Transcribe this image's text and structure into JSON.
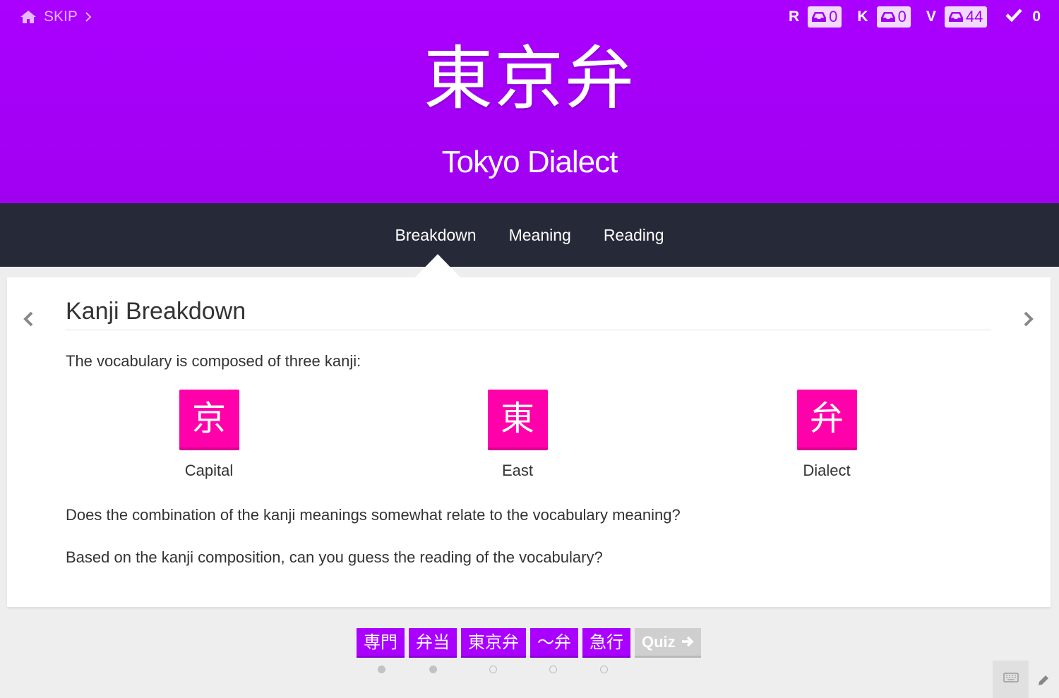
{
  "header": {
    "skip_label": "SKIP",
    "vocab_japanese": "東京弁",
    "vocab_meaning": "Tokyo Dialect",
    "background_color": "#aa00ff",
    "counters": [
      {
        "label": "R",
        "value": "0"
      },
      {
        "label": "K",
        "value": "0"
      },
      {
        "label": "V",
        "value": "44"
      }
    ],
    "completed_count": "0"
  },
  "tabs": [
    {
      "label": "Breakdown",
      "active": true
    },
    {
      "label": "Meaning",
      "active": false
    },
    {
      "label": "Reading",
      "active": false
    }
  ],
  "breakdown": {
    "title": "Kanji Breakdown",
    "intro": "The vocabulary is composed of three kanji:",
    "kanji": [
      {
        "character": "京",
        "meaning": "Capital"
      },
      {
        "character": "東",
        "meaning": "East"
      },
      {
        "character": "弁",
        "meaning": "Dialect"
      }
    ],
    "question_meaning": "Does the combination of the kanji meanings somewhat relate to the vocabulary meaning?",
    "question_reading": "Based on the kanji composition, can you guess the reading of the vocabulary?",
    "kanji_color": "#ff00aa"
  },
  "lesson_queue": {
    "items": [
      "専門",
      "弁当",
      "東京弁",
      "〜弁",
      "急行"
    ],
    "quiz_label": "Quiz",
    "progress": [
      "viewed",
      "viewed",
      "current",
      "unviewed",
      "unviewed"
    ]
  },
  "icons": [
    "home-icon",
    "chevron-right-icon",
    "inbox-icon",
    "check-icon",
    "chevron-left-icon",
    "arrow-right-icon",
    "keyboard-icon",
    "pencil-icon"
  ]
}
